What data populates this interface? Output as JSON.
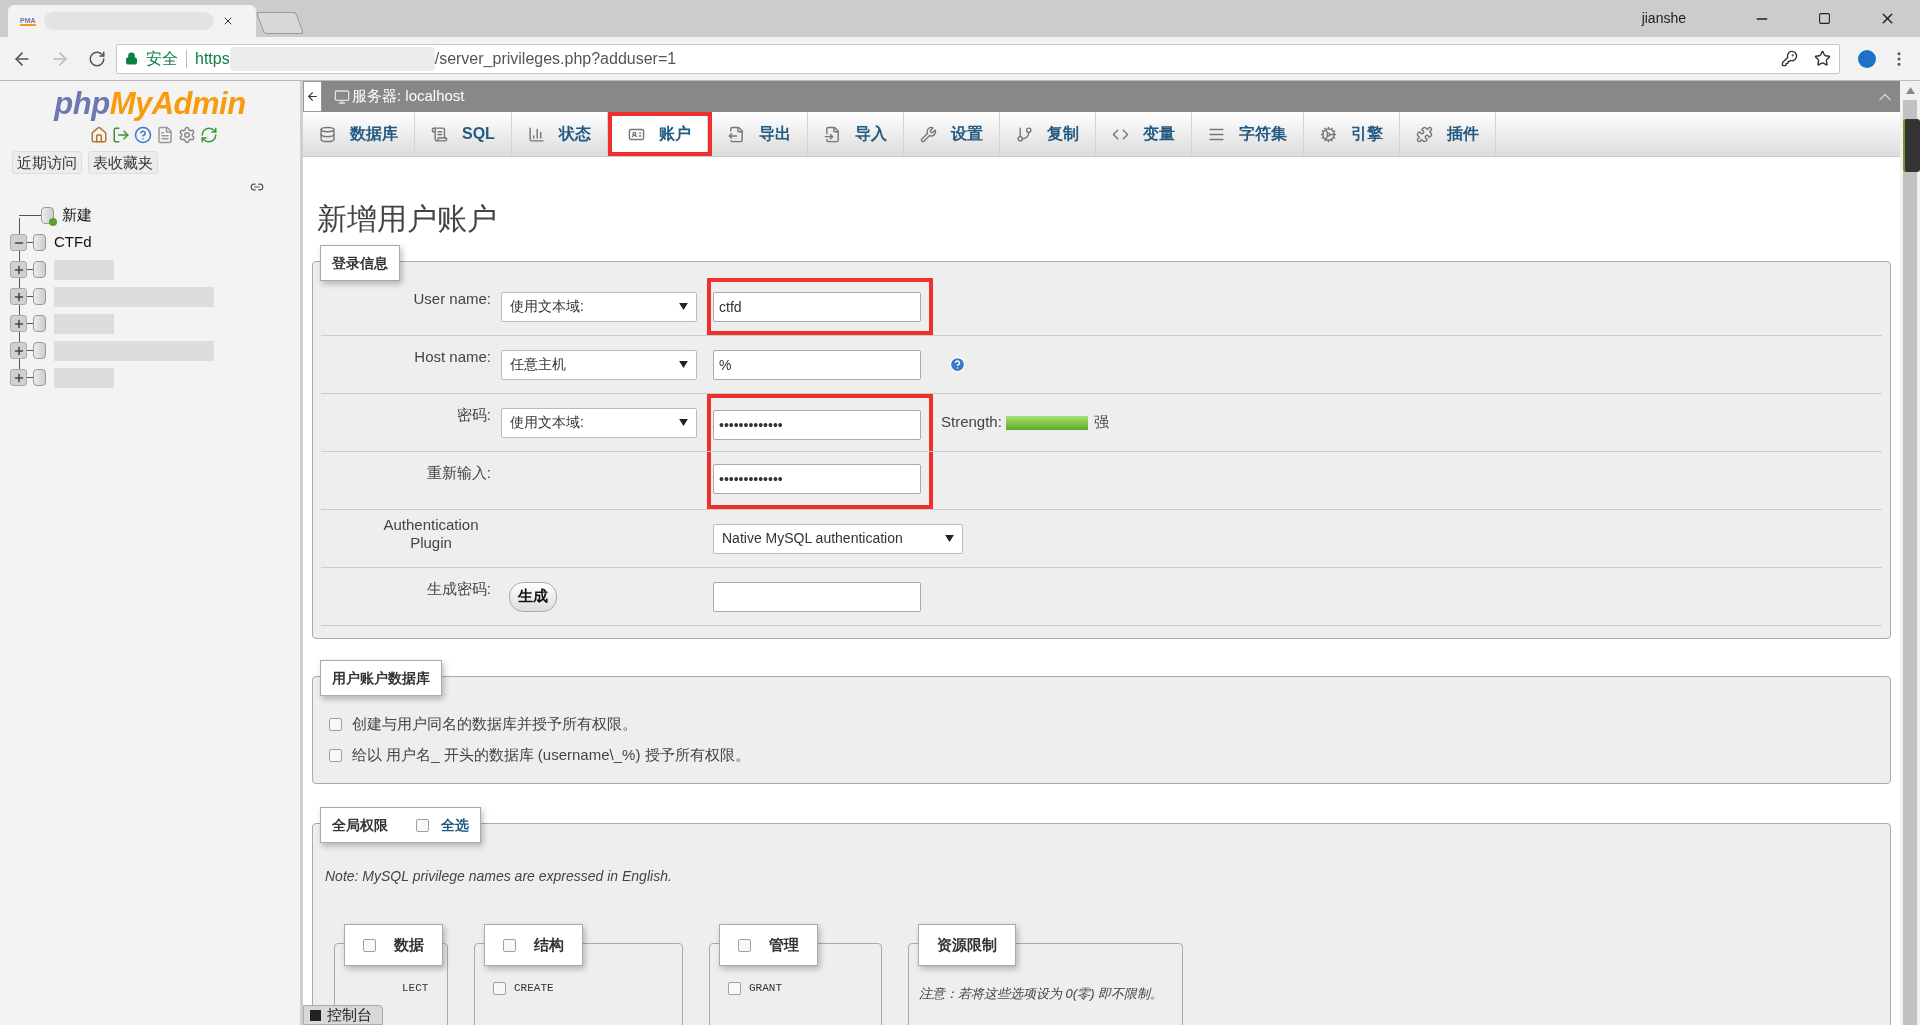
{
  "browser": {
    "favicon_text": "PMA",
    "user": "jianshe",
    "address": {
      "security": "安全",
      "scheme": "https",
      "path": "/server_privileges.php?adduser=1"
    }
  },
  "sidebar": {
    "logo": {
      "part_1": "php",
      "part_2": "MyAdmin"
    },
    "buttons": [
      "近期访问",
      "表收藏夹"
    ],
    "tree": [
      {
        "kind": "new",
        "label": "新建"
      },
      {
        "kind": "db",
        "label": "CTFd",
        "expanded": true
      },
      {
        "kind": "redacted",
        "expanded": false
      },
      {
        "kind": "redacted",
        "expanded": false
      },
      {
        "kind": "redacted",
        "expanded": false
      },
      {
        "kind": "redacted",
        "expanded": false
      },
      {
        "kind": "redacted",
        "expanded": false
      }
    ]
  },
  "server_bar": {
    "title": "服务器: localhost"
  },
  "tabs": [
    {
      "label": "数据库",
      "selected": false,
      "highlighted": false
    },
    {
      "label": "SQL",
      "selected": false,
      "highlighted": false
    },
    {
      "label": "状态",
      "selected": false,
      "highlighted": false
    },
    {
      "label": "账户",
      "selected": true,
      "highlighted": true
    },
    {
      "label": "导出",
      "selected": false,
      "highlighted": false
    },
    {
      "label": "导入",
      "selected": false,
      "highlighted": false
    },
    {
      "label": "设置",
      "selected": false,
      "highlighted": false
    },
    {
      "label": "复制",
      "selected": false,
      "highlighted": false
    },
    {
      "label": "变量",
      "selected": false,
      "highlighted": false
    },
    {
      "label": "字符集",
      "selected": false,
      "highlighted": false
    },
    {
      "label": "引擎",
      "selected": false,
      "highlighted": false
    },
    {
      "label": "插件",
      "selected": false,
      "highlighted": false
    }
  ],
  "page_title": "新增用户账户",
  "login_info": {
    "legend": "登录信息",
    "rows": [
      {
        "kind": "text",
        "label": "User name:",
        "select": "使用文本域:",
        "value": "ctfd",
        "highlighted": true
      },
      {
        "kind": "text",
        "label": "Host name:",
        "select": "任意主机",
        "value": "%",
        "help": true,
        "highlighted": false
      },
      {
        "kind": "text",
        "label": "密码:",
        "select": "使用文本域:",
        "value": "•••••••••••••",
        "strength": {
          "label": "Strength:",
          "level": 1,
          "text": "强"
        },
        "highlighted": true
      },
      {
        "kind": "text",
        "label": "重新输入:",
        "value": "•••••••••••••",
        "highlighted": true
      },
      {
        "kind": "dropdown",
        "label": "Authentication Plugin",
        "value": "Native MySQL authentication",
        "highlighted": false
      },
      {
        "kind": "generate",
        "label": "生成密码:",
        "button": "生成",
        "highlighted": false
      }
    ]
  },
  "user_database": {
    "legend": "用户账户数据库",
    "options": [
      {
        "label": "创建与用户同名的数据库并授予所有权限。",
        "checked": false
      },
      {
        "label": "给以 用户名_ 开头的数据库 (username\\_%) 授予所有权限。",
        "checked": false
      }
    ]
  },
  "global_privileges": {
    "legend": "全局权限",
    "select_all": {
      "label": "全选",
      "checked": false
    },
    "note": "Note: MySQL privilege names are expressed in English.",
    "groups": [
      {
        "kind": "privileges",
        "legend": "数据",
        "checked": false,
        "items": [
          {
            "label": "LECT"
          }
        ]
      },
      {
        "kind": "privileges",
        "legend": "结构",
        "checked": false,
        "items": [
          {
            "label": "CREATE",
            "checked": false
          }
        ]
      },
      {
        "kind": "privileges",
        "legend": "管理",
        "checked": false,
        "items": [
          {
            "label": "GRANT",
            "checked": false
          }
        ]
      },
      {
        "kind": "limits",
        "legend": "资源限制",
        "note": "注意：若将这些选项设为 0(零) 即不限制。"
      }
    ]
  },
  "console": {
    "label": "控制台"
  }
}
